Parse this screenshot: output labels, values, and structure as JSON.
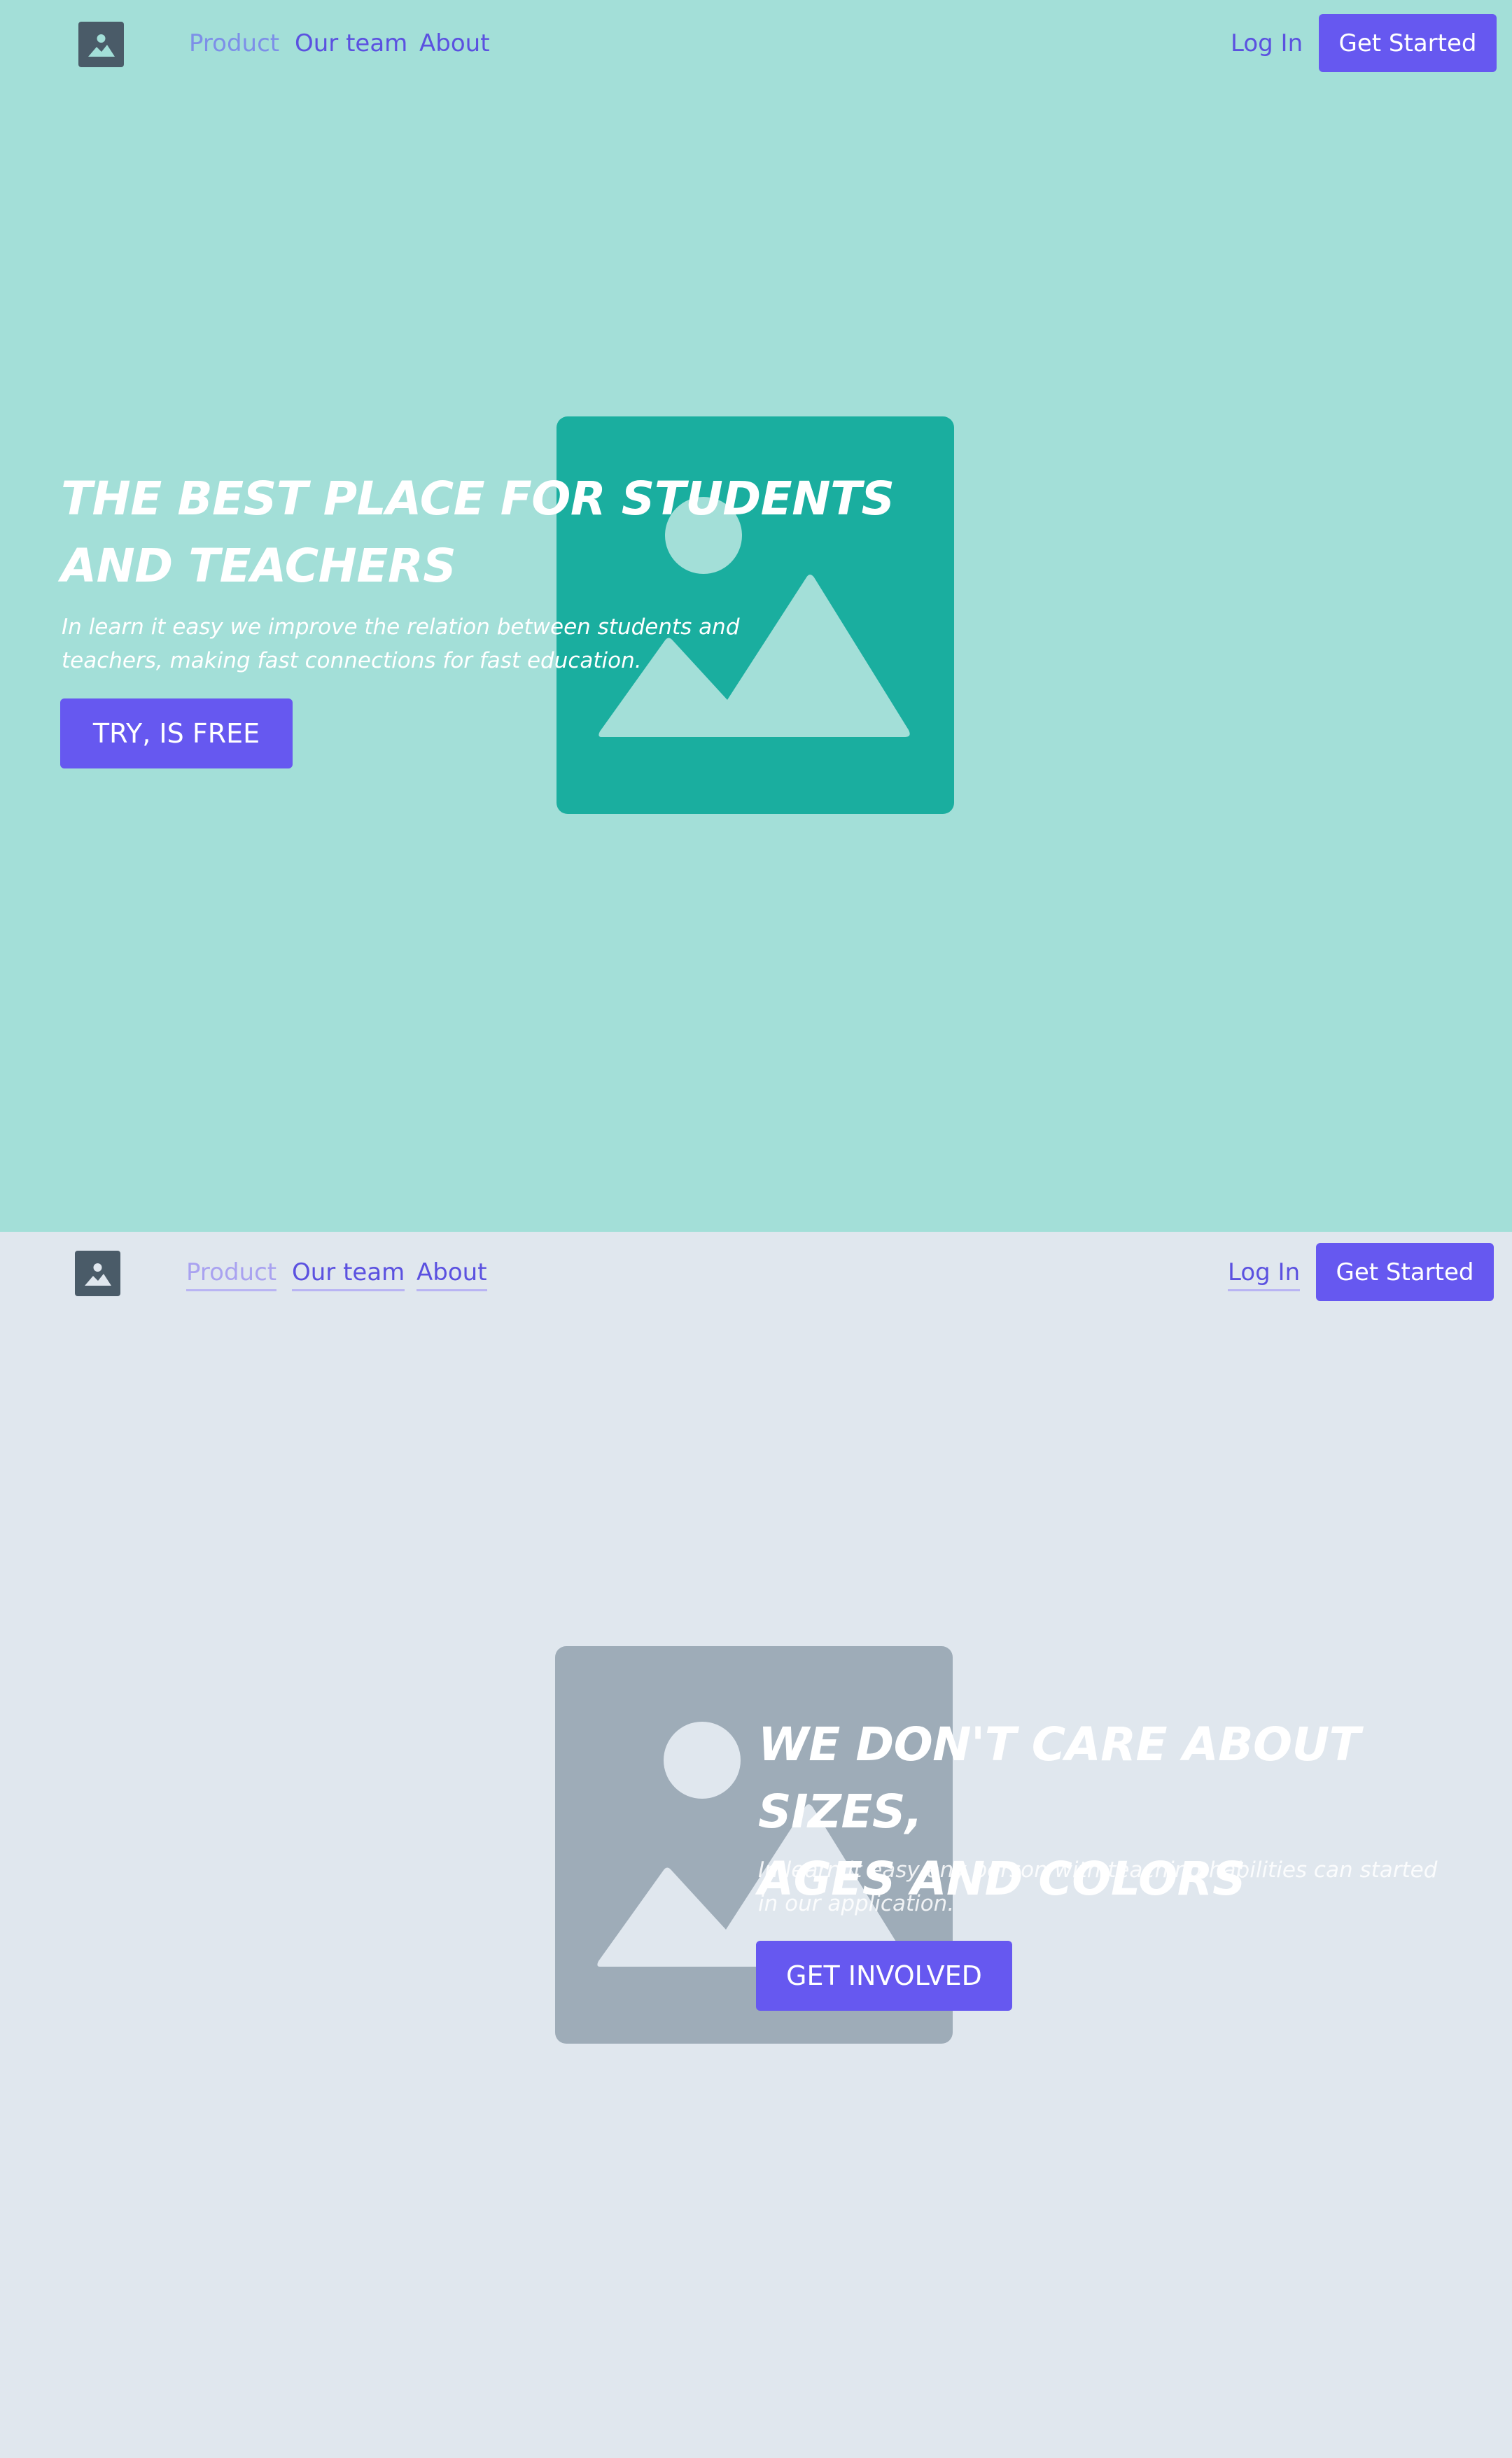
{
  "hero": {
    "nav": {
      "logo_icon": "image-placeholder-icon",
      "links": [
        "Product",
        "Our team",
        "About"
      ],
      "login": "Log In",
      "cta": "Get Started"
    },
    "title_line1": "THE BEST PLACE FOR STUDENTS",
    "title_line2": "AND TEACHERS",
    "subtitle_line1": "In learn it easy we improve the relation between students and",
    "subtitle_line2": "teachers, making fast connections for fast education.",
    "button": "TRY, IS FREE",
    "image_icon": "image-placeholder-icon"
  },
  "features": {
    "nav": {
      "logo_icon": "image-placeholder-icon",
      "links": [
        "Product",
        "Our team",
        "About"
      ],
      "login": "Log In",
      "cta": "Get Started"
    },
    "title_line1": "WE DON'T CARE ABOUT SIZES,",
    "title_line2": "AGES AND COLORS",
    "subtitle_line1": "In learn it easy any person with teaching habilities can started",
    "subtitle_line2": "in our application.",
    "button": "GET INVOLVED",
    "image_icon": "image-placeholder-icon"
  },
  "colors": {
    "hero_bg": "#a3dfd8",
    "features_bg": "#e0e7ee",
    "accent": "#6658f0",
    "link": "#5b51e0",
    "hero_image": "#1aae9f",
    "features_image": "#9eacb8",
    "logo": "#4a5b68"
  }
}
